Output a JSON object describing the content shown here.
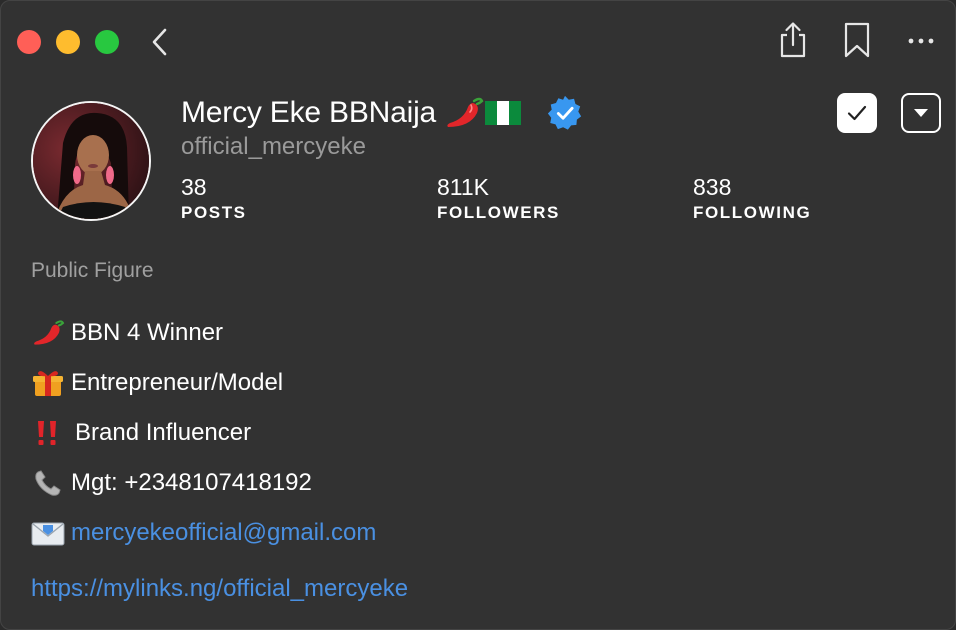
{
  "window": {
    "controls": [
      "close",
      "minimize",
      "zoom"
    ]
  },
  "toolbar": {
    "back_icon": "chevron-left-icon",
    "share_icon": "share-icon",
    "bookmark_icon": "bookmark-icon",
    "more_icon": "more-icon"
  },
  "profile": {
    "display_name": "Mercy Eke BBNaija",
    "name_emoji": [
      "chili-pepper-icon",
      "nigeria-flag-icon"
    ],
    "verified": true,
    "username": "official_mercyeke",
    "stats": [
      {
        "value": "38",
        "label": "POSTS"
      },
      {
        "value": "811K",
        "label": "FOLLOWERS"
      },
      {
        "value": "838",
        "label": "FOLLOWING"
      }
    ],
    "category": "Public Figure",
    "bio": [
      {
        "icon": "chili-pepper-icon",
        "text": "BBN 4 Winner"
      },
      {
        "icon": "gift-icon",
        "text": "Entrepreneur/Model"
      },
      {
        "icon": "double-exclamation-icon",
        "text": "Brand Influencer"
      },
      {
        "icon": "telephone-icon",
        "text": "Mgt: +2348107418192"
      },
      {
        "icon": "envelope-icon",
        "text": "mercyekeofficial@gmail.com"
      }
    ],
    "website": "https://mylinks.ng/official_mercyeke"
  },
  "actions": {
    "follow_state_icon": "checkmark-icon",
    "dropdown_icon": "dropdown-arrow-icon"
  },
  "colors": {
    "background": "#323232",
    "link": "#4a90e2",
    "verified_badge": "#3897f0",
    "secondary_text": "#9a9a9a"
  }
}
